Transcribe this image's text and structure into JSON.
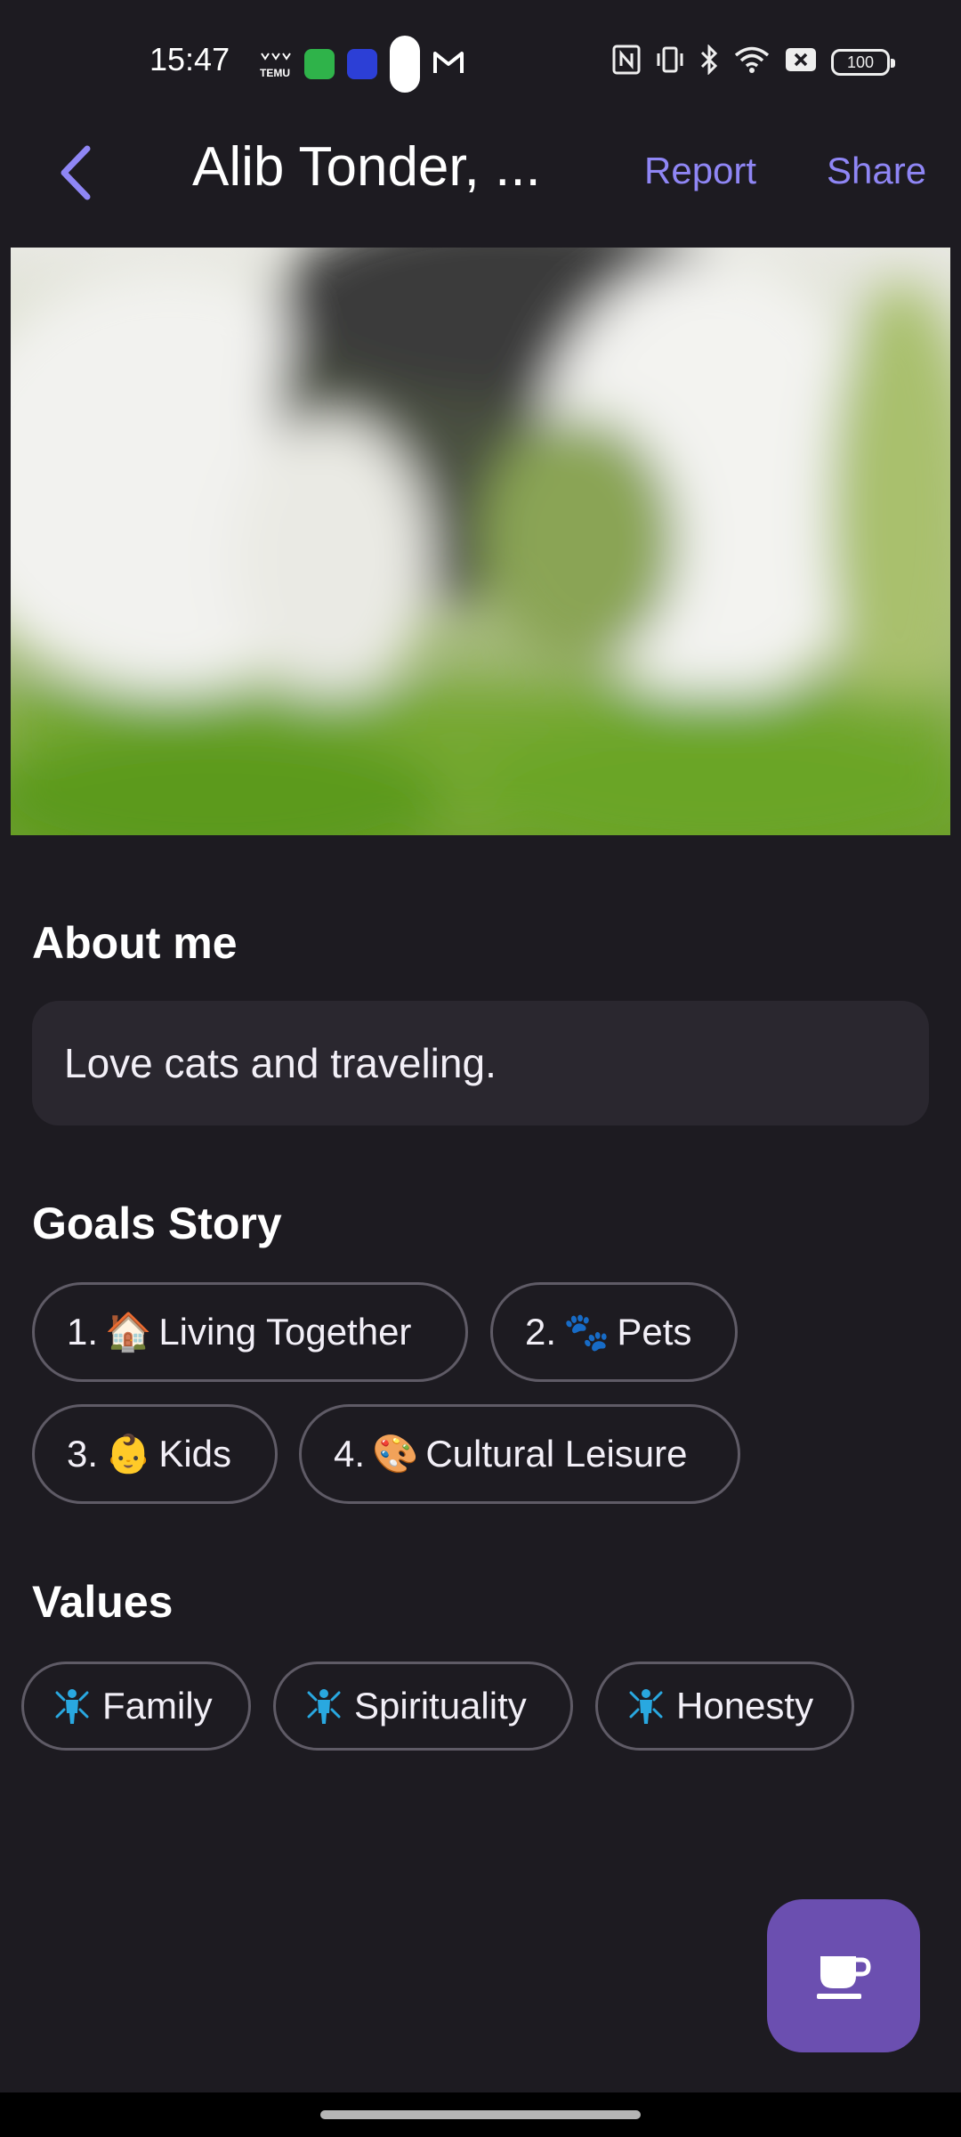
{
  "status_bar": {
    "time": "15:47",
    "temu_label": "TEMU",
    "battery": "100",
    "icons_left": [
      "temu-icon",
      "green-app-icon",
      "blue-app-icon",
      "pill-icon",
      "gmail-icon"
    ],
    "icons_right": [
      "nfc-icon",
      "vibrate-icon",
      "bluetooth-icon",
      "wifi-icon",
      "sim-off-icon",
      "battery-icon"
    ]
  },
  "app_bar": {
    "title": "Alib Tonder, ...",
    "report_label": "Report",
    "share_label": "Share"
  },
  "about": {
    "heading": "About me",
    "text": "Love cats and traveling."
  },
  "goals": {
    "heading": "Goals Story",
    "items": [
      {
        "number": "1.",
        "emoji": "🏠",
        "label": "Living Together"
      },
      {
        "number": "2.",
        "emoji": "🐾",
        "label": "Pets"
      },
      {
        "number": "3.",
        "emoji": "👶",
        "label": "Kids"
      },
      {
        "number": "4.",
        "emoji": "🎨",
        "label": "Cultural Leisure"
      }
    ]
  },
  "values": {
    "heading": "Values",
    "items": [
      {
        "label": "Family",
        "icon": "person-icon"
      },
      {
        "label": "Spirituality",
        "icon": "person-icon"
      },
      {
        "label": "Honesty",
        "icon": "person-icon"
      }
    ]
  },
  "fab": {
    "icon": "coffee-cup-icon"
  },
  "colors": {
    "background": "#1d1b21",
    "accent": "#8f86f5",
    "fab": "#6b4fb0",
    "card": "#2a272f",
    "value_icon": "#29a8e0"
  }
}
